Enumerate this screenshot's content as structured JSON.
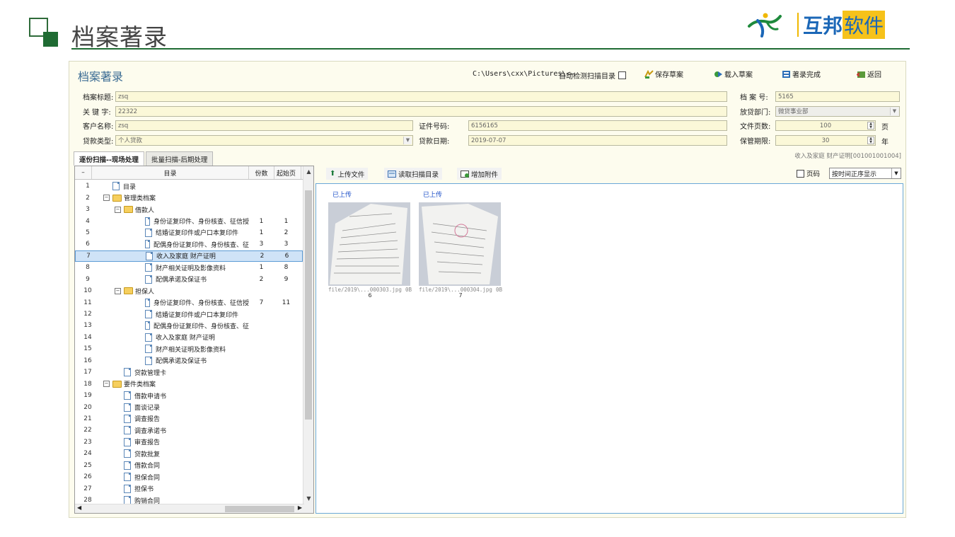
{
  "slide": {
    "title": "档案著录",
    "brand": {
      "name_main": "互邦",
      "name_highlight": "软件",
      "icon": "person-logo-icon"
    }
  },
  "window": {
    "title": "档案著录",
    "path": "C:\\Users\\cxx\\Pictures\\<—",
    "auto_detect_label": "自动检测扫描目录",
    "toolbar": {
      "save_draft": "保存草案",
      "load_draft": "载入草案",
      "finish": "著录完成",
      "back": "返回"
    }
  },
  "form": {
    "title_label": "档案标题:",
    "title_value": "zsq",
    "keywords_label": "关 键 字:",
    "keywords_value": "22322",
    "customer_label": "客户名称:",
    "customer_value": "zsq",
    "cert_label": "证件号码:",
    "cert_value": "6156165",
    "loan_type_label": "贷款类型:",
    "loan_type_value": "个人贷款",
    "loan_date_label": "贷款日期:",
    "loan_date_value": "2019-07-07",
    "archive_no_label": "档 案 号:",
    "archive_no_value": "5165",
    "dept_label": "放贷部门:",
    "dept_value": "微贷事业部",
    "pages_label": "文件页数:",
    "pages_value": "100",
    "pages_unit": "页",
    "retention_label": "保管期限:",
    "retention_value": "30",
    "retention_unit": "年"
  },
  "tabs": [
    {
      "label": "逐份扫描--现场处理",
      "active": true
    },
    {
      "label": "批量扫描-后期处理",
      "active": false
    }
  ],
  "tab_hint": "收入及家庭 财产证明[001001001004]",
  "tree": {
    "header": {
      "collapse": "–",
      "catalog": "目录",
      "copies": "份数",
      "start_page": "起始页"
    },
    "rows": [
      {
        "num": "1",
        "label": "目录",
        "level": 1,
        "type": "doc",
        "copies": "",
        "page": ""
      },
      {
        "num": "2",
        "label": "管理类档案",
        "level": 1,
        "type": "folder",
        "expander": "⊟",
        "copies": "",
        "page": ""
      },
      {
        "num": "3",
        "label": "借款人",
        "level": 2,
        "type": "folder",
        "expander": "⊟",
        "copies": "",
        "page": ""
      },
      {
        "num": "4",
        "label": "身份证复印件、身份核查、征信授",
        "level": 3,
        "type": "doc",
        "copies": "1",
        "page": "1"
      },
      {
        "num": "5",
        "label": "结婚证复印件或户口本复印件",
        "level": 3,
        "type": "doc",
        "copies": "1",
        "page": "2"
      },
      {
        "num": "6",
        "label": "配偶身份证复印件、身份核查、征",
        "level": 3,
        "type": "doc",
        "copies": "3",
        "page": "3"
      },
      {
        "num": "7",
        "label": "收入及家庭 财产证明",
        "level": 3,
        "type": "doc",
        "copies": "2",
        "page": "6",
        "selected": true
      },
      {
        "num": "8",
        "label": "财产相关证明及影像资料",
        "level": 3,
        "type": "doc",
        "copies": "1",
        "page": "8"
      },
      {
        "num": "9",
        "label": "配偶承诺及保证书",
        "level": 3,
        "type": "doc",
        "copies": "2",
        "page": "9"
      },
      {
        "num": "10",
        "label": "担保人",
        "level": 2,
        "type": "folder",
        "expander": "⊟",
        "copies": "",
        "page": ""
      },
      {
        "num": "11",
        "label": "身份证复印件、身份核查、征信授",
        "level": 3,
        "type": "doc",
        "copies": "7",
        "page": "11"
      },
      {
        "num": "12",
        "label": "结婚证复印件或户口本复印件",
        "level": 3,
        "type": "doc",
        "copies": "",
        "page": ""
      },
      {
        "num": "13",
        "label": "配偶身份证复印件、身份核查、征",
        "level": 3,
        "type": "doc",
        "copies": "",
        "page": ""
      },
      {
        "num": "14",
        "label": "收入及家庭 财产证明",
        "level": 3,
        "type": "doc",
        "copies": "",
        "page": ""
      },
      {
        "num": "15",
        "label": "财产相关证明及影像资料",
        "level": 3,
        "type": "doc",
        "copies": "",
        "page": ""
      },
      {
        "num": "16",
        "label": "配偶承诺及保证书",
        "level": 3,
        "type": "doc",
        "copies": "",
        "page": ""
      },
      {
        "num": "17",
        "label": "贷款管理卡",
        "level": 2,
        "type": "doc",
        "copies": "",
        "page": ""
      },
      {
        "num": "18",
        "label": "要件类档案",
        "level": 1,
        "type": "folder",
        "expander": "⊟",
        "copies": "",
        "page": ""
      },
      {
        "num": "19",
        "label": "借款申请书",
        "level": 2,
        "type": "doc",
        "copies": "",
        "page": ""
      },
      {
        "num": "20",
        "label": "面谈记录",
        "level": 2,
        "type": "doc",
        "copies": "",
        "page": ""
      },
      {
        "num": "21",
        "label": "调查报告",
        "level": 2,
        "type": "doc",
        "copies": "",
        "page": ""
      },
      {
        "num": "22",
        "label": "调查承诺书",
        "level": 2,
        "type": "doc",
        "copies": "",
        "page": ""
      },
      {
        "num": "23",
        "label": "审查报告",
        "level": 2,
        "type": "doc",
        "copies": "",
        "page": ""
      },
      {
        "num": "24",
        "label": "贷款批复",
        "level": 2,
        "type": "doc",
        "copies": "",
        "page": ""
      },
      {
        "num": "25",
        "label": "借款合同",
        "level": 2,
        "type": "doc",
        "copies": "",
        "page": ""
      },
      {
        "num": "26",
        "label": "担保合同",
        "level": 2,
        "type": "doc",
        "copies": "",
        "page": ""
      },
      {
        "num": "27",
        "label": "担保书",
        "level": 2,
        "type": "doc",
        "copies": "",
        "page": ""
      },
      {
        "num": "28",
        "label": "购销合同",
        "level": 2,
        "type": "doc",
        "copies": "",
        "page": ""
      }
    ]
  },
  "scan_panel": {
    "upload_btn": "上传文件",
    "read_dir_btn": "读取扫描目录",
    "add_attach_btn": "增加附件",
    "page_code_label": "页码",
    "sort_value": "按时间正序显示",
    "thumbnails": [
      {
        "status": "已上传",
        "file": "file/2019\\...000303.jpg",
        "size": "0B",
        "seq": "6"
      },
      {
        "status": "已上传",
        "file": "file/2019\\...000304.jpg",
        "size": "0B",
        "seq": "7"
      }
    ]
  }
}
